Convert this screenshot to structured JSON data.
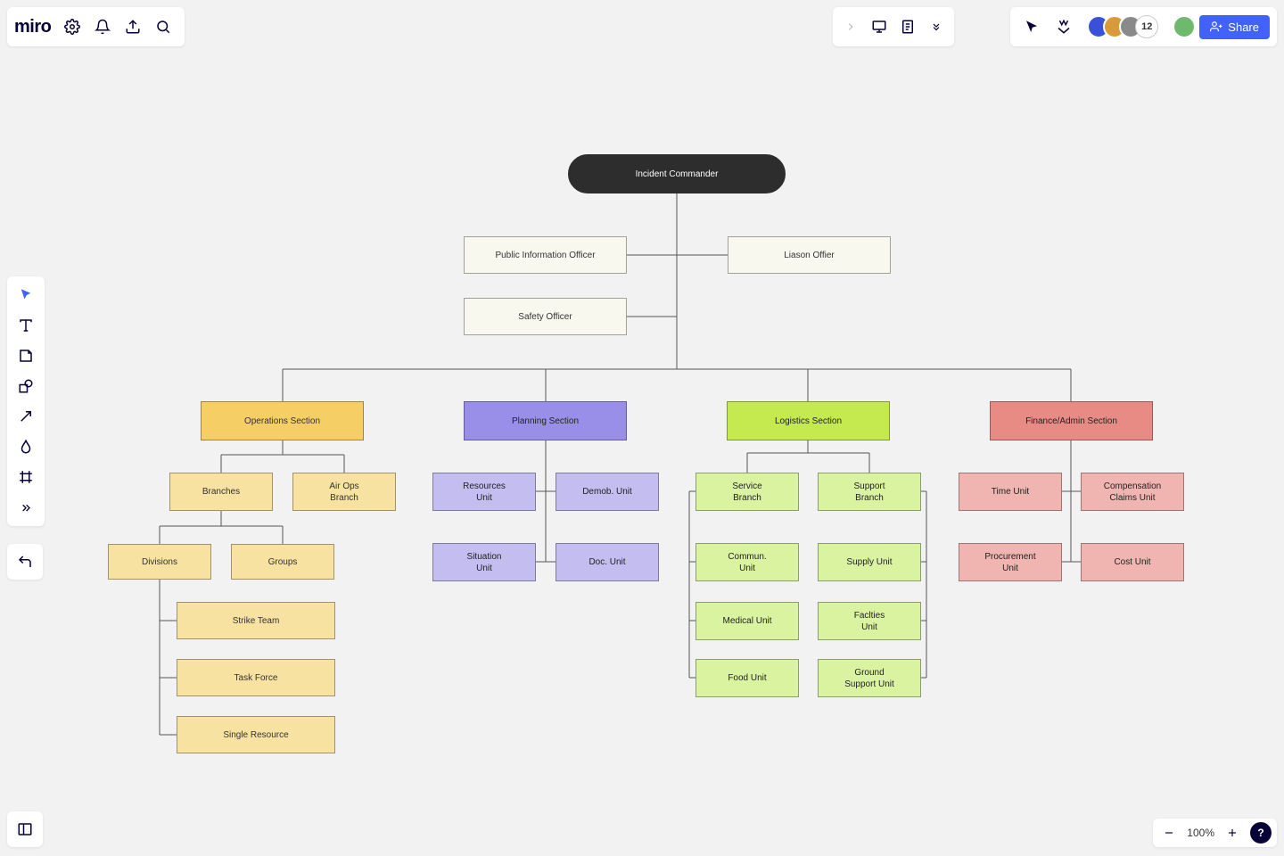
{
  "app": {
    "logo": "miro"
  },
  "topbar": {
    "avatar_overflow": "12",
    "share_label": "Share"
  },
  "zoom": {
    "label": "100%",
    "help": "?"
  },
  "diagram": {
    "root": "Incident Commander",
    "staff": {
      "pio": "Public Information Officer",
      "liaison": "Liason Offier",
      "safety": "Safety Officer"
    },
    "sections": {
      "ops": {
        "title": "Operations Section"
      },
      "planning": {
        "title": "Planning Section"
      },
      "logistics": {
        "title": "Logistics Section"
      },
      "finance": {
        "title": "Finance/Admin Section"
      }
    },
    "ops": {
      "branches": "Branches",
      "air_ops": "Air Ops\nBranch",
      "divisions": "Divisions",
      "groups": "Groups",
      "strike": "Strike Team",
      "task": "Task Force",
      "single": "Single Resource"
    },
    "planning": {
      "resources": "Resources\nUnit",
      "demob": "Demob. Unit",
      "situation": "Situation\nUnit",
      "doc": "Doc. Unit"
    },
    "logistics": {
      "service": "Service\nBranch",
      "support": "Support\nBranch",
      "commun": "Commun.\nUnit",
      "supply": "Supply Unit",
      "medical": "Medical Unit",
      "facilities": "Faclties\nUnit",
      "food": "Food Unit",
      "ground": "Ground\nSupport Unit"
    },
    "finance": {
      "time": "Time Unit",
      "comp": "Compensation\nClaims Unit",
      "procurement": "Procurement\nUnit",
      "cost": "Cost Unit"
    }
  }
}
